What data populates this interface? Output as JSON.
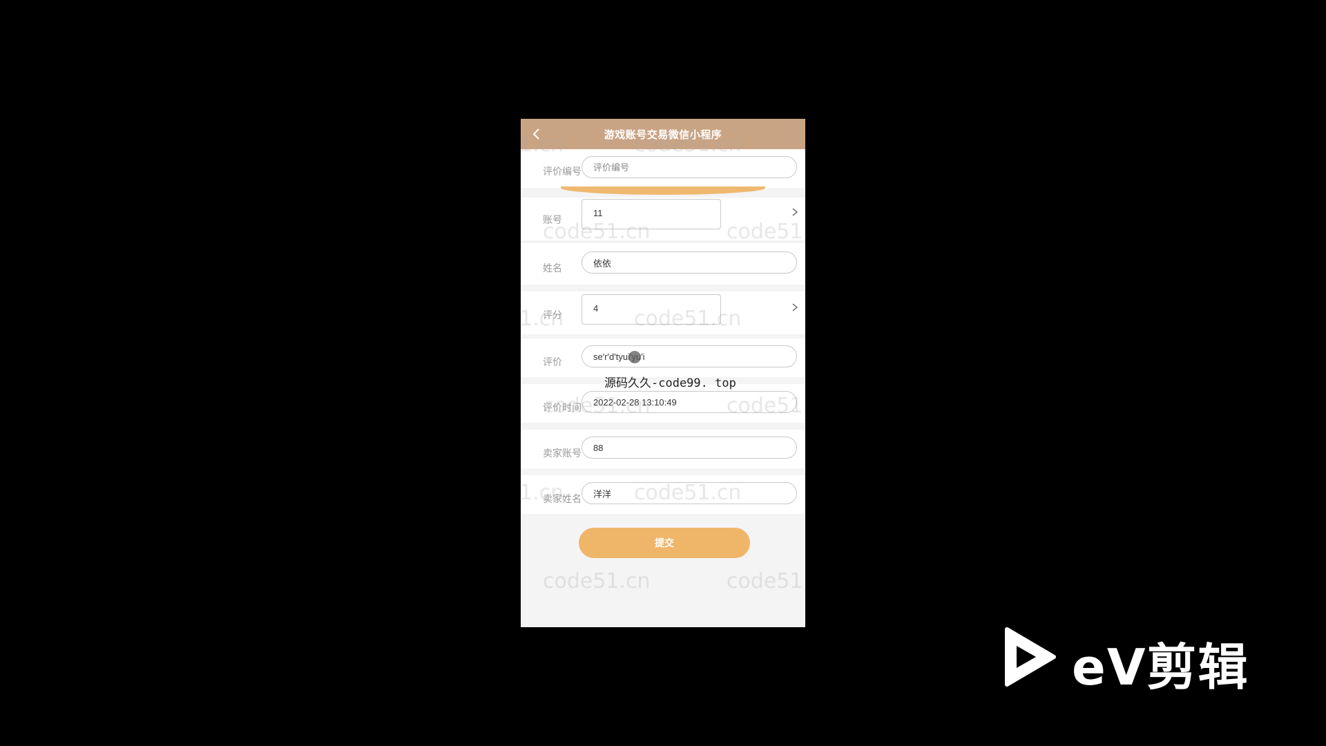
{
  "app": {
    "title": "游戏账号交易微信小程序"
  },
  "form": {
    "review_id": {
      "label": "评价编号",
      "placeholder": "评价编号",
      "value": ""
    },
    "account": {
      "label": "账号",
      "value": "11"
    },
    "name": {
      "label": "姓名",
      "value": "依依"
    },
    "score": {
      "label": "评分",
      "value": "4"
    },
    "review": {
      "label": "评价",
      "value": "se'r'd'tyui'yu'i"
    },
    "review_time": {
      "label": "评价时间",
      "value": "2022-02-28 13:10:49"
    },
    "seller_account": {
      "label": "卖家账号",
      "value": "88"
    },
    "seller_name": {
      "label": "卖家姓名",
      "value": "洋洋"
    },
    "submit_label": "提交"
  },
  "watermark_text": "code51.cn",
  "watermark_partial_left": "1.cn",
  "watermark_partial_right": "code51",
  "overlay_caption": "源码久久-code99. top",
  "editor_logo": {
    "text": "eV剪辑"
  },
  "colors": {
    "nav_bg": "#c9a484",
    "accent": "#efb66a",
    "page_bg": "#000000"
  },
  "icons": [
    "back-arrow-icon",
    "chevron-right-icon",
    "play-triangle-icon"
  ]
}
